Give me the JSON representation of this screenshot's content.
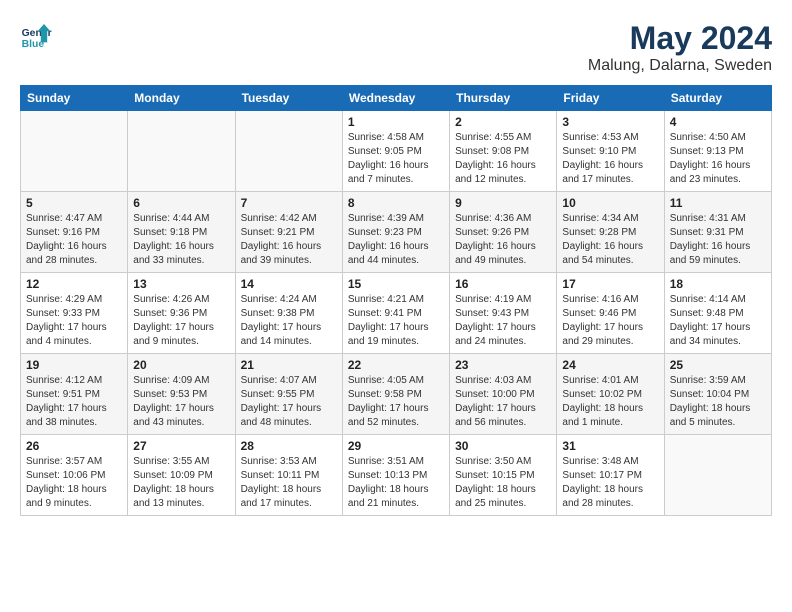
{
  "header": {
    "logo_line1": "General",
    "logo_line2": "Blue",
    "month": "May 2024",
    "location": "Malung, Dalarna, Sweden"
  },
  "weekdays": [
    "Sunday",
    "Monday",
    "Tuesday",
    "Wednesday",
    "Thursday",
    "Friday",
    "Saturday"
  ],
  "weeks": [
    [
      {
        "day": "",
        "info": ""
      },
      {
        "day": "",
        "info": ""
      },
      {
        "day": "",
        "info": ""
      },
      {
        "day": "1",
        "info": "Sunrise: 4:58 AM\nSunset: 9:05 PM\nDaylight: 16 hours\nand 7 minutes."
      },
      {
        "day": "2",
        "info": "Sunrise: 4:55 AM\nSunset: 9:08 PM\nDaylight: 16 hours\nand 12 minutes."
      },
      {
        "day": "3",
        "info": "Sunrise: 4:53 AM\nSunset: 9:10 PM\nDaylight: 16 hours\nand 17 minutes."
      },
      {
        "day": "4",
        "info": "Sunrise: 4:50 AM\nSunset: 9:13 PM\nDaylight: 16 hours\nand 23 minutes."
      }
    ],
    [
      {
        "day": "5",
        "info": "Sunrise: 4:47 AM\nSunset: 9:16 PM\nDaylight: 16 hours\nand 28 minutes."
      },
      {
        "day": "6",
        "info": "Sunrise: 4:44 AM\nSunset: 9:18 PM\nDaylight: 16 hours\nand 33 minutes."
      },
      {
        "day": "7",
        "info": "Sunrise: 4:42 AM\nSunset: 9:21 PM\nDaylight: 16 hours\nand 39 minutes."
      },
      {
        "day": "8",
        "info": "Sunrise: 4:39 AM\nSunset: 9:23 PM\nDaylight: 16 hours\nand 44 minutes."
      },
      {
        "day": "9",
        "info": "Sunrise: 4:36 AM\nSunset: 9:26 PM\nDaylight: 16 hours\nand 49 minutes."
      },
      {
        "day": "10",
        "info": "Sunrise: 4:34 AM\nSunset: 9:28 PM\nDaylight: 16 hours\nand 54 minutes."
      },
      {
        "day": "11",
        "info": "Sunrise: 4:31 AM\nSunset: 9:31 PM\nDaylight: 16 hours\nand 59 minutes."
      }
    ],
    [
      {
        "day": "12",
        "info": "Sunrise: 4:29 AM\nSunset: 9:33 PM\nDaylight: 17 hours\nand 4 minutes."
      },
      {
        "day": "13",
        "info": "Sunrise: 4:26 AM\nSunset: 9:36 PM\nDaylight: 17 hours\nand 9 minutes."
      },
      {
        "day": "14",
        "info": "Sunrise: 4:24 AM\nSunset: 9:38 PM\nDaylight: 17 hours\nand 14 minutes."
      },
      {
        "day": "15",
        "info": "Sunrise: 4:21 AM\nSunset: 9:41 PM\nDaylight: 17 hours\nand 19 minutes."
      },
      {
        "day": "16",
        "info": "Sunrise: 4:19 AM\nSunset: 9:43 PM\nDaylight: 17 hours\nand 24 minutes."
      },
      {
        "day": "17",
        "info": "Sunrise: 4:16 AM\nSunset: 9:46 PM\nDaylight: 17 hours\nand 29 minutes."
      },
      {
        "day": "18",
        "info": "Sunrise: 4:14 AM\nSunset: 9:48 PM\nDaylight: 17 hours\nand 34 minutes."
      }
    ],
    [
      {
        "day": "19",
        "info": "Sunrise: 4:12 AM\nSunset: 9:51 PM\nDaylight: 17 hours\nand 38 minutes."
      },
      {
        "day": "20",
        "info": "Sunrise: 4:09 AM\nSunset: 9:53 PM\nDaylight: 17 hours\nand 43 minutes."
      },
      {
        "day": "21",
        "info": "Sunrise: 4:07 AM\nSunset: 9:55 PM\nDaylight: 17 hours\nand 48 minutes."
      },
      {
        "day": "22",
        "info": "Sunrise: 4:05 AM\nSunset: 9:58 PM\nDaylight: 17 hours\nand 52 minutes."
      },
      {
        "day": "23",
        "info": "Sunrise: 4:03 AM\nSunset: 10:00 PM\nDaylight: 17 hours\nand 56 minutes."
      },
      {
        "day": "24",
        "info": "Sunrise: 4:01 AM\nSunset: 10:02 PM\nDaylight: 18 hours\nand 1 minute."
      },
      {
        "day": "25",
        "info": "Sunrise: 3:59 AM\nSunset: 10:04 PM\nDaylight: 18 hours\nand 5 minutes."
      }
    ],
    [
      {
        "day": "26",
        "info": "Sunrise: 3:57 AM\nSunset: 10:06 PM\nDaylight: 18 hours\nand 9 minutes."
      },
      {
        "day": "27",
        "info": "Sunrise: 3:55 AM\nSunset: 10:09 PM\nDaylight: 18 hours\nand 13 minutes."
      },
      {
        "day": "28",
        "info": "Sunrise: 3:53 AM\nSunset: 10:11 PM\nDaylight: 18 hours\nand 17 minutes."
      },
      {
        "day": "29",
        "info": "Sunrise: 3:51 AM\nSunset: 10:13 PM\nDaylight: 18 hours\nand 21 minutes."
      },
      {
        "day": "30",
        "info": "Sunrise: 3:50 AM\nSunset: 10:15 PM\nDaylight: 18 hours\nand 25 minutes."
      },
      {
        "day": "31",
        "info": "Sunrise: 3:48 AM\nSunset: 10:17 PM\nDaylight: 18 hours\nand 28 minutes."
      },
      {
        "day": "",
        "info": ""
      }
    ]
  ]
}
